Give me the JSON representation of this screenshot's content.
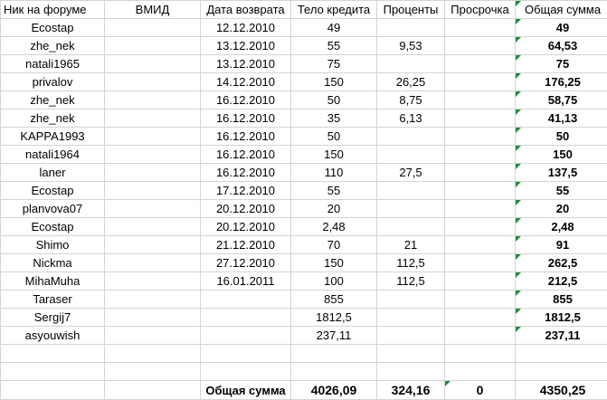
{
  "headers": [
    "Ник на форуме",
    "ВМИД",
    "Дата возврата",
    "Тело кредита",
    "Проценты",
    "Просрочка",
    "Общая сумма"
  ],
  "rows": [
    {
      "nick": "Ecostap",
      "wmid": "",
      "date": "12.12.2010",
      "body": "49",
      "interest": "",
      "overdue": "",
      "total": "49"
    },
    {
      "nick": "zhe_nek",
      "wmid": "",
      "date": "13.12.2010",
      "body": "55",
      "interest": "9,53",
      "overdue": "",
      "total": "64,53"
    },
    {
      "nick": "natali1965",
      "wmid": "",
      "date": "13.12.2010",
      "body": "75",
      "interest": "",
      "overdue": "",
      "total": "75"
    },
    {
      "nick": "privalov",
      "wmid": "",
      "date": "14.12.2010",
      "body": "150",
      "interest": "26,25",
      "overdue": "",
      "total": "176,25"
    },
    {
      "nick": "zhe_nek",
      "wmid": "",
      "date": "16.12.2010",
      "body": "50",
      "interest": "8,75",
      "overdue": "",
      "total": "58,75"
    },
    {
      "nick": "zhe_nek",
      "wmid": "",
      "date": "16.12.2010",
      "body": "35",
      "interest": "6,13",
      "overdue": "",
      "total": "41,13"
    },
    {
      "nick": "KAPPA1993",
      "wmid": "",
      "date": "16.12.2010",
      "body": "50",
      "interest": "",
      "overdue": "",
      "total": "50"
    },
    {
      "nick": "natali1964",
      "wmid": "",
      "date": "16.12.2010",
      "body": "150",
      "interest": "",
      "overdue": "",
      "total": "150"
    },
    {
      "nick": "laner",
      "wmid": "",
      "date": "16.12.2010",
      "body": "110",
      "interest": "27,5",
      "overdue": "",
      "total": "137,5"
    },
    {
      "nick": "Ecostap",
      "wmid": "",
      "date": "17.12.2010",
      "body": "55",
      "interest": "",
      "overdue": "",
      "total": "55"
    },
    {
      "nick": "planvova07",
      "wmid": "",
      "date": "20.12.2010",
      "body": "20",
      "interest": "",
      "overdue": "",
      "total": "20"
    },
    {
      "nick": "Ecostap",
      "wmid": "",
      "date": "20.12.2010",
      "body": "2,48",
      "interest": "",
      "overdue": "",
      "total": "2,48"
    },
    {
      "nick": "Shimo",
      "wmid": "",
      "date": "21.12.2010",
      "body": "70",
      "interest": "21",
      "overdue": "",
      "total": "91"
    },
    {
      "nick": "Nickma",
      "wmid": "",
      "date": "27.12.2010",
      "body": "150",
      "interest": "112,5",
      "overdue": "",
      "total": "262,5"
    },
    {
      "nick": "MihaMuha",
      "wmid": "",
      "date": "16.01.2011",
      "body": "100",
      "interest": "112,5",
      "overdue": "",
      "total": "212,5"
    },
    {
      "nick": "Taraser",
      "wmid": "",
      "date": "",
      "body": "855",
      "interest": "",
      "overdue": "",
      "total": "855"
    },
    {
      "nick": "Sergij7",
      "wmid": "",
      "date": "",
      "body": "1812,5",
      "interest": "",
      "overdue": "",
      "total": "1812,5"
    },
    {
      "nick": "asyouwish",
      "wmid": "",
      "date": "",
      "body": "237,11",
      "interest": "",
      "overdue": "",
      "total": "237,11"
    },
    {
      "nick": "",
      "wmid": "",
      "date": "",
      "body": "",
      "interest": "",
      "overdue": "",
      "total": ""
    },
    {
      "nick": "",
      "wmid": "",
      "date": "",
      "body": "",
      "interest": "",
      "overdue": "",
      "total": ""
    }
  ],
  "totals": {
    "label": "Общая сумма",
    "body": "4026,09",
    "interest": "324,16",
    "overdue": "0",
    "total": "4350,25"
  },
  "colors": {
    "grid": "#d4d4d4",
    "error_marker": "#1e8c3a"
  }
}
